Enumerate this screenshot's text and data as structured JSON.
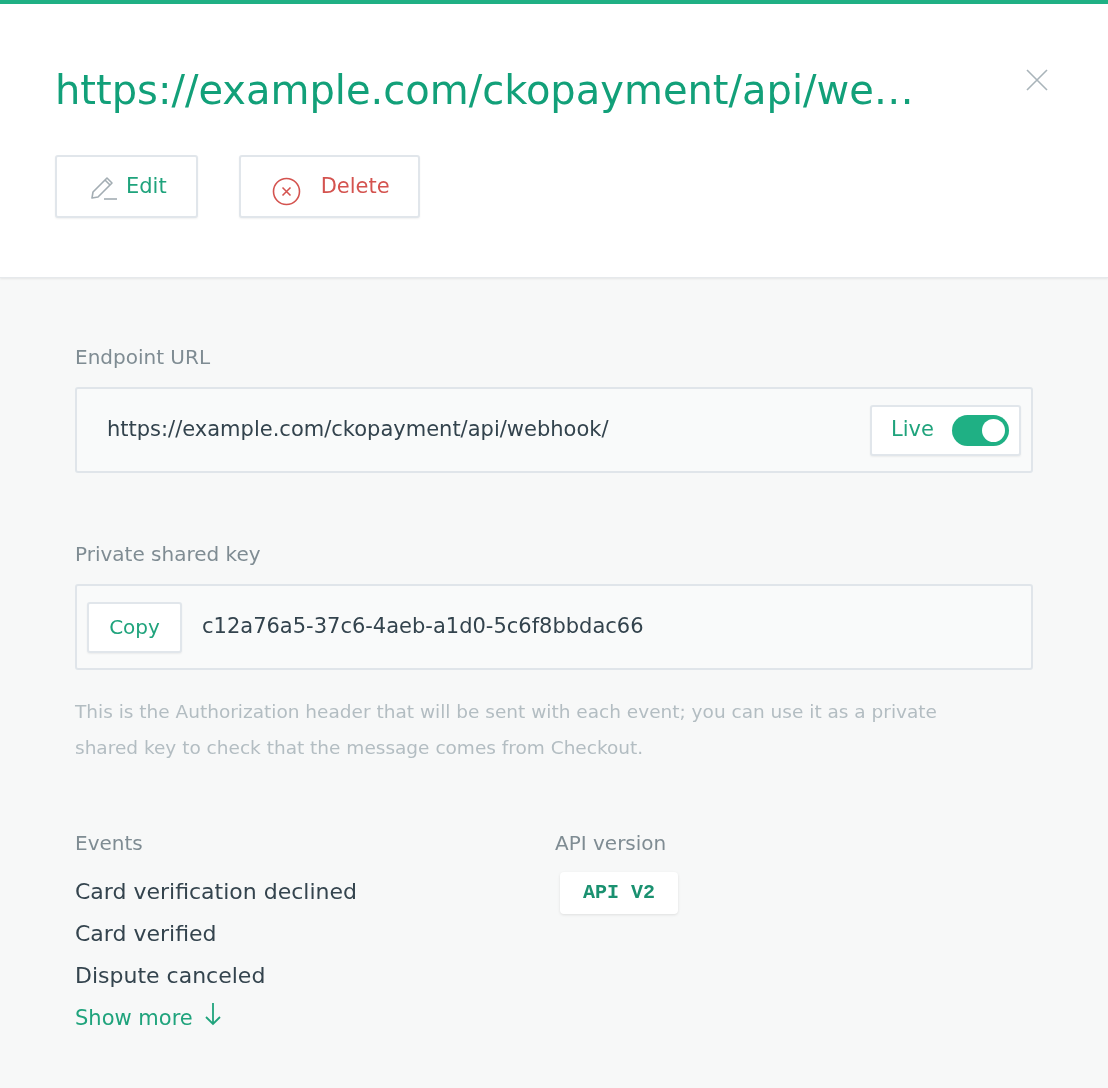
{
  "header": {
    "title": "https://example.com/ckopayment/api/we…",
    "actions": [
      {
        "kind": "edit",
        "label": "Edit"
      },
      {
        "kind": "delete",
        "label": "Delete"
      }
    ]
  },
  "endpoint": {
    "label": "Endpoint URL",
    "value": "https://example.com/ckopayment/api/webhook/",
    "live": {
      "label": "Live",
      "on": true
    }
  },
  "private_key": {
    "label": "Private shared key",
    "copy_button": "Copy",
    "value": "c12a76a5-37c6-4aeb-a1d0-5c6f8bbdac66",
    "help": "This is the Authorization header that will be sent with each event; you can use it as a private shared key to check that the message comes from Checkout."
  },
  "events": {
    "label": "Events",
    "items": [
      "Card verification declined",
      "Card verified",
      "Dispute canceled"
    ],
    "show_more": "Show more"
  },
  "api_version": {
    "label": "API version",
    "value": "API V2"
  }
}
